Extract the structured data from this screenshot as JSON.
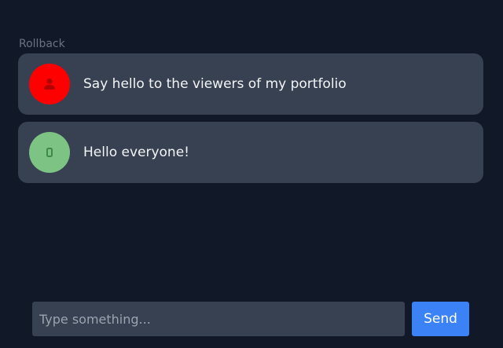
{
  "header": {
    "rollback_label": "Rollback"
  },
  "messages": [
    {
      "role": "user",
      "avatar_icon": "person-icon",
      "avatar_color": "#ff0000",
      "text": "Say hello to the viewers of my portfolio"
    },
    {
      "role": "bot",
      "avatar_icon": "bot-icon",
      "avatar_color": "#7dc383",
      "text": "Hello everyone!"
    }
  ],
  "composer": {
    "placeholder": "Type something...",
    "value": "",
    "send_label": "Send"
  },
  "colors": {
    "background": "#111827",
    "message_bg": "#374151",
    "accent": "#3b82f6"
  }
}
